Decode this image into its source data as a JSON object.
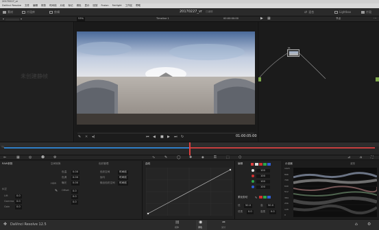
{
  "os": {
    "title": "20170227_vr"
  },
  "menu": [
    "DaVinci Resolve",
    "文件",
    "编辑",
    "修剪",
    "时间线",
    "片段",
    "标记",
    "调色",
    "显示",
    "回放",
    "Fusion",
    "Fairlight",
    "工作区",
    "帮助"
  ],
  "header": {
    "tab_media": "素材",
    "tab_library": "片段库",
    "tab_edit": "剪辑",
    "project_title": "20170227_vr",
    "project_status": "已编辑",
    "mix_label": "混合",
    "lightbox_label": "Lightbox",
    "clips_label": "片段"
  },
  "viewer": {
    "zoom": "53%",
    "timeline_name": "Timeline 1",
    "source_tc": "00:00:00:00",
    "timecode": "01:00:05:00"
  },
  "left_pane": {
    "empty_text": "未创建静帧"
  },
  "nodes": {
    "label": "节点",
    "node_id": "01"
  },
  "timeline_strip": {
    "label": "T1"
  },
  "primaries": {
    "title": "RAW参数",
    "tab1": "空间转换",
    "tab2": "色彩管理",
    "field_a": "色温",
    "field_b": "色调",
    "field_c": "曝光",
    "value_a": "0.00",
    "value_b": "0.00",
    "value_c": "0.00"
  },
  "color_mgmt": {
    "label1": "色彩空间",
    "label2": "伽马",
    "label3": "输出色彩空间",
    "label4": "输出伽马",
    "value1": "时间线",
    "value2": "时间线",
    "value3": "时间线",
    "value4": "时间线"
  },
  "bottom_tabs": {
    "t1": "纠正",
    "t2": "HDR",
    "t3": "其它"
  },
  "bottom_fields": {
    "lift": "Lift",
    "gamma": "Gamma",
    "gain": "Gain",
    "offset": "Offset",
    "lift_val": "0.0",
    "gamma_val": "0.0",
    "gain_val": "0.0"
  },
  "curves": {
    "title": "曲线"
  },
  "editor": {
    "title": "编辑",
    "channels": [
      "Y",
      "R",
      "G",
      "B"
    ],
    "channel_colors": [
      "#dddddd",
      "#d23030",
      "#2da64a",
      "#2f60d8"
    ],
    "values": [
      "100",
      "100",
      "100",
      "100"
    ],
    "soft_clip_title": "柔化剪切",
    "low": "低",
    "high": "高",
    "low_val": "50.0",
    "high_val": "50.0",
    "ls_label": "低柔",
    "hs_label": "高柔",
    "ls_val": "0.0",
    "hs_val": "0.0"
  },
  "scope": {
    "title": "示波器",
    "mode": "波形",
    "ticks": [
      "1023",
      "896",
      "768",
      "640",
      "512",
      "384",
      "256",
      "128",
      "0"
    ]
  },
  "status": {
    "app_name": "DaVinci Resolve 12.5"
  },
  "page_tabs": {
    "media": "媒体",
    "edit": "剪辑",
    "color": "调色",
    "deliver": "交付"
  }
}
